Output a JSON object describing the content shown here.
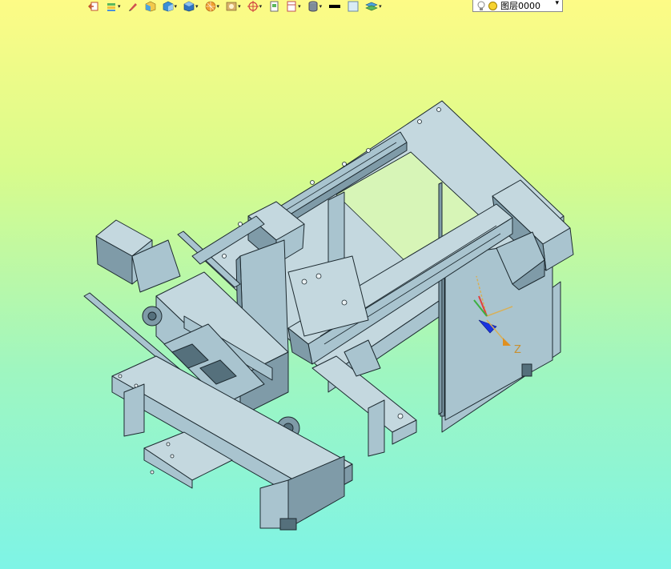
{
  "toolbar": {
    "buttons": [
      {
        "name": "exit-icon",
        "dropdown": false
      },
      {
        "name": "stack-icon",
        "dropdown": true
      },
      {
        "name": "pencil-icon",
        "dropdown": false
      },
      {
        "name": "cube-yellow-icon",
        "dropdown": false
      },
      {
        "name": "cube-blue-icon",
        "dropdown": true
      },
      {
        "name": "cube-view-icon",
        "dropdown": true
      },
      {
        "name": "sphere-icon",
        "dropdown": true
      },
      {
        "name": "render-icon",
        "dropdown": true
      },
      {
        "name": "target-icon",
        "dropdown": true
      },
      {
        "name": "page-icon",
        "dropdown": false
      },
      {
        "name": "frame-icon",
        "dropdown": true
      },
      {
        "name": "database-icon",
        "dropdown": true
      },
      {
        "name": "line-color-swatch",
        "dropdown": false
      },
      {
        "name": "fill-color-swatch",
        "dropdown": false
      },
      {
        "name": "layers-icon",
        "dropdown": true
      }
    ],
    "layer": {
      "label": "图层0000",
      "selected": "图层0000"
    }
  },
  "axis": {
    "z_label": "Z"
  },
  "colors": {
    "bg_top": "#fdfb86",
    "bg_bottom": "#7ef4e6",
    "metal": "#a9c4cf",
    "metal_dark": "#6f8c99",
    "edge": "#1d2a30"
  }
}
